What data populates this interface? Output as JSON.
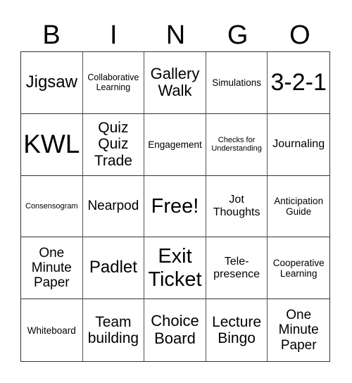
{
  "header": {
    "letters": [
      "B",
      "I",
      "N",
      "G",
      "O"
    ]
  },
  "board": {
    "cells": [
      "Jigsaw",
      "Collaborative Learning",
      "Gallery Walk",
      "Simulations",
      "3-2-1",
      "KWL",
      "Quiz Quiz Trade",
      "Engagement",
      "Checks for Understanding",
      "Journaling",
      "Consensogram",
      "Nearpod",
      "Free!",
      "Jot Thoughts",
      "Anticipation Guide",
      "One Minute Paper",
      "Padlet",
      "Exit Ticket",
      "Tele- presence",
      "Cooperative Learning",
      "Whiteboard",
      "Team building",
      "Choice Board",
      "Lecture Bingo",
      "One Minute Paper"
    ]
  }
}
